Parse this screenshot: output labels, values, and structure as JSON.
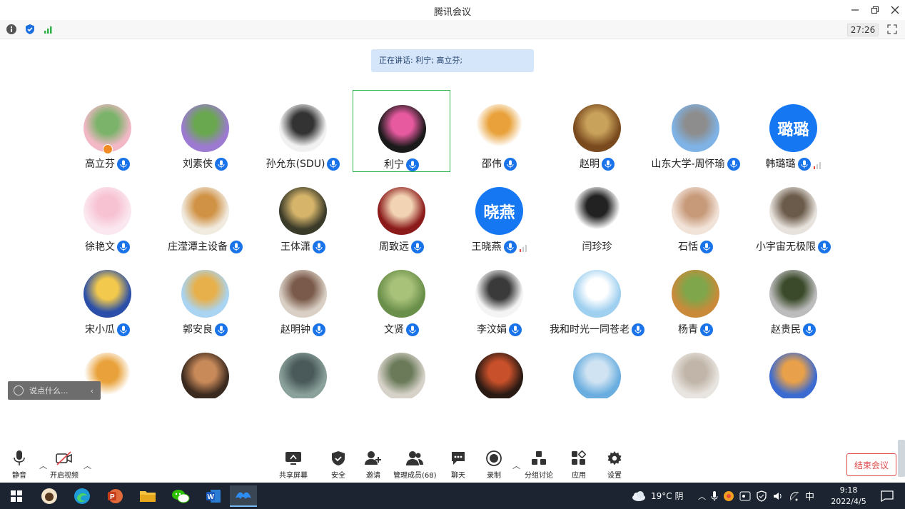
{
  "window": {
    "title": "腾讯会议"
  },
  "infobar": {
    "timer": "27:26"
  },
  "speaking": "正在讲话: 利宁; 高立芬;",
  "participants": [
    {
      "name": "高立芬",
      "type": "img",
      "colors": [
        "#f2b8c6",
        "#7bb36a"
      ],
      "badge": true
    },
    {
      "name": "刘素侠",
      "type": "img",
      "colors": [
        "#9c7ad1",
        "#6aa84f"
      ]
    },
    {
      "name": "孙允东(SDU)",
      "type": "img",
      "colors": [
        "#f1f1f1",
        "#333333"
      ]
    },
    {
      "name": "利宁",
      "type": "img",
      "colors": [
        "#1a1a1a",
        "#e85aa0"
      ],
      "active": true
    },
    {
      "name": "邵伟",
      "type": "img",
      "colors": [
        "#ffffff",
        "#e9a23b"
      ]
    },
    {
      "name": "赵明",
      "type": "img",
      "colors": [
        "#7a4a1f",
        "#c8a15a"
      ]
    },
    {
      "name": "山东大学-周怀瑜",
      "type": "img",
      "colors": [
        "#7fb3e6",
        "#8d8d8d"
      ]
    },
    {
      "name": "韩璐璐",
      "type": "text",
      "text": "璐璐",
      "colors": [
        "#1677f2",
        "#1677f2"
      ],
      "signal": "#e8453c"
    },
    {
      "name": "徐艳文",
      "type": "img",
      "colors": [
        "#fbe7ef",
        "#f7c3d3"
      ]
    },
    {
      "name": "庄滢潭主设备",
      "type": "img",
      "colors": [
        "#f0eadf",
        "#d09245"
      ]
    },
    {
      "name": "王体潇",
      "type": "img",
      "colors": [
        "#3b3b2a",
        "#d6b56a"
      ]
    },
    {
      "name": "周致远",
      "type": "img",
      "colors": [
        "#8b1a1a",
        "#f2d3b3"
      ]
    },
    {
      "name": "王晓燕",
      "type": "text",
      "text": "晓燕",
      "colors": [
        "#1677f2",
        "#1677f2"
      ],
      "signal": "#e8453c"
    },
    {
      "name": "闫珍珍",
      "type": "img",
      "colors": [
        "#ffffff",
        "#222222"
      ],
      "nomic": true
    },
    {
      "name": "石恬",
      "type": "img",
      "colors": [
        "#f2e3d9",
        "#c79a7a"
      ]
    },
    {
      "name": "小宇宙无极限",
      "type": "img",
      "colors": [
        "#e7e2dc",
        "#6b5b4a"
      ]
    },
    {
      "name": "宋小瓜",
      "type": "img",
      "colors": [
        "#2b4fa8",
        "#f2c94c"
      ]
    },
    {
      "name": "郭安良",
      "type": "img",
      "colors": [
        "#a9d4f2",
        "#e8b04a"
      ]
    },
    {
      "name": "赵明钟",
      "type": "img",
      "colors": [
        "#d9cfc4",
        "#7a5a4a"
      ]
    },
    {
      "name": "文贤",
      "type": "img",
      "colors": [
        "#6a8f4a",
        "#a9c27a"
      ]
    },
    {
      "name": "李汶娟",
      "type": "img",
      "colors": [
        "#f4f4f4",
        "#3a3a3a"
      ]
    },
    {
      "name": "我和时光一同苍老",
      "type": "img",
      "colors": [
        "#9fd0f0",
        "#ffffff"
      ]
    },
    {
      "name": "杨青",
      "type": "img",
      "colors": [
        "#c98a3a",
        "#7fa64a"
      ]
    },
    {
      "name": "赵贵民",
      "type": "img",
      "colors": [
        "#bcbcbc",
        "#3b4a2a"
      ]
    },
    {
      "name": "",
      "type": "img",
      "colors": [
        "#ffffff",
        "#e9a23b"
      ]
    },
    {
      "name": "",
      "type": "img",
      "colors": [
        "#3b2a1f",
        "#c98a5a"
      ]
    },
    {
      "name": "",
      "type": "img",
      "colors": [
        "#8aa09a",
        "#4a5a5a"
      ]
    },
    {
      "name": "",
      "type": "img",
      "colors": [
        "#d7d2c9",
        "#6b7b5a"
      ]
    },
    {
      "name": "",
      "type": "img",
      "colors": [
        "#2a1a14",
        "#c8502a"
      ]
    },
    {
      "name": "",
      "type": "img",
      "colors": [
        "#6aaee0",
        "#cfe3f2"
      ]
    },
    {
      "name": "",
      "type": "img",
      "colors": [
        "#e8e4df",
        "#c0b5a8"
      ]
    },
    {
      "name": "",
      "type": "img",
      "colors": [
        "#3b6bd1",
        "#e8a04a"
      ]
    }
  ],
  "chat": {
    "placeholder": "说点什么..."
  },
  "toolbar": {
    "mute": "静音",
    "video": "开启视频",
    "share": "共享屏幕",
    "security": "安全",
    "invite": "邀请",
    "members": "管理成员(68)",
    "chat": "聊天",
    "record": "录制",
    "breakout": "分组讨论",
    "apps": "应用",
    "settings": "设置",
    "end": "结束会议"
  },
  "taskbar": {
    "weather": "19°C 阴",
    "ime": "中",
    "time": "9:18",
    "date": "2022/4/5"
  },
  "colors": {
    "accent": "#1677f2",
    "active_border": "#28b44b",
    "end": "#e04a4a",
    "speaking_bg": "#d5e6fb"
  }
}
